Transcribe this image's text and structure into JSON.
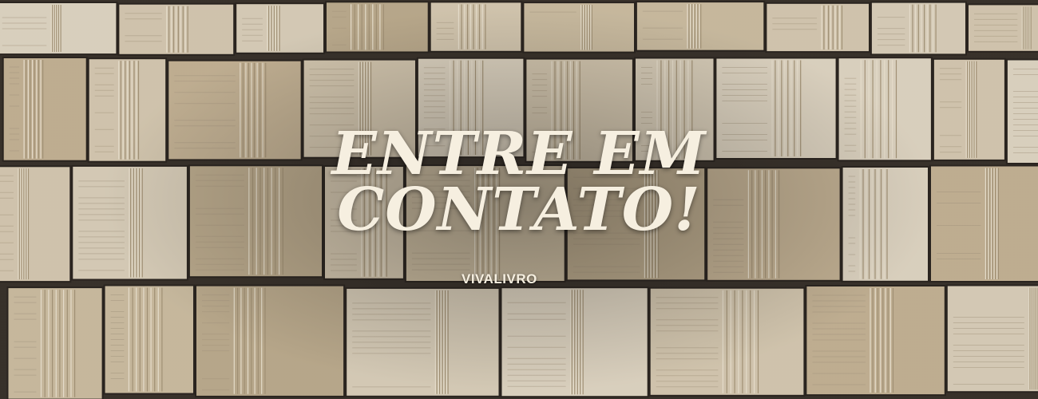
{
  "banner": {
    "headline_line1": "ENTRE EM",
    "headline_line2": "CONTATO!",
    "brand": "VIVALIVRO"
  },
  "colors": {
    "text": "#f6efe0",
    "background": "#35302b"
  }
}
